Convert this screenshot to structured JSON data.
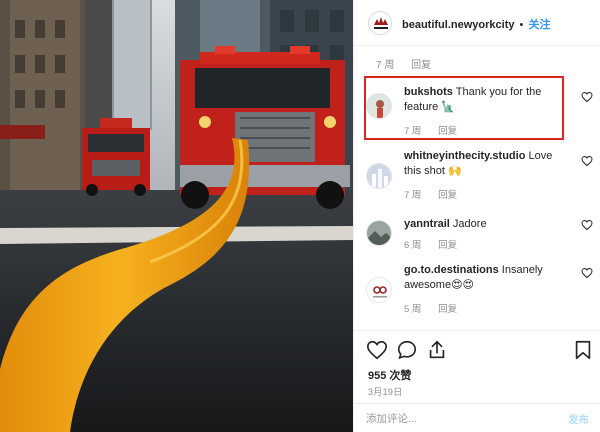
{
  "header": {
    "username": "beautiful.newyorkcity",
    "separator": "•",
    "follow_label": "关注",
    "avatar_caption": "NEW YORK"
  },
  "top_comment_meta": {
    "age": "7 周",
    "reply": "回复"
  },
  "comments": [
    {
      "username": "bukshots",
      "text": "Thank you for the feature 🗽",
      "age": "7 周",
      "reply": "回复",
      "highlighted": true
    },
    {
      "username": "whitneyinthecity.studio",
      "text": "Love this shot 🙌",
      "age": "7 周",
      "reply": "回复",
      "highlighted": false
    },
    {
      "username": "yanntrail",
      "text": "Jadore",
      "age": "6 周",
      "reply": "回复",
      "highlighted": false
    },
    {
      "username": "go.to.destinations",
      "text": "Insanely awesome😍😍",
      "age": "5 周",
      "reply": "回复",
      "highlighted": false
    }
  ],
  "engagement": {
    "likes": "955 次赞",
    "date": "3月19日"
  },
  "add_comment": {
    "placeholder": "添加评论...",
    "post_label": "发布"
  },
  "icons": {
    "like": "heart-outline",
    "comment": "speech-bubble-outline",
    "share": "share-upload",
    "save": "bookmark-outline",
    "comment_like": "heart-small-outline"
  },
  "colors": {
    "accent_blue": "#3897f0",
    "highlight_red": "#d9261c",
    "muted_text": "#8e8e8e",
    "post_disabled": "#b2dffc",
    "hose_orange": "#f0a21a",
    "truck_red": "#c0221b"
  }
}
